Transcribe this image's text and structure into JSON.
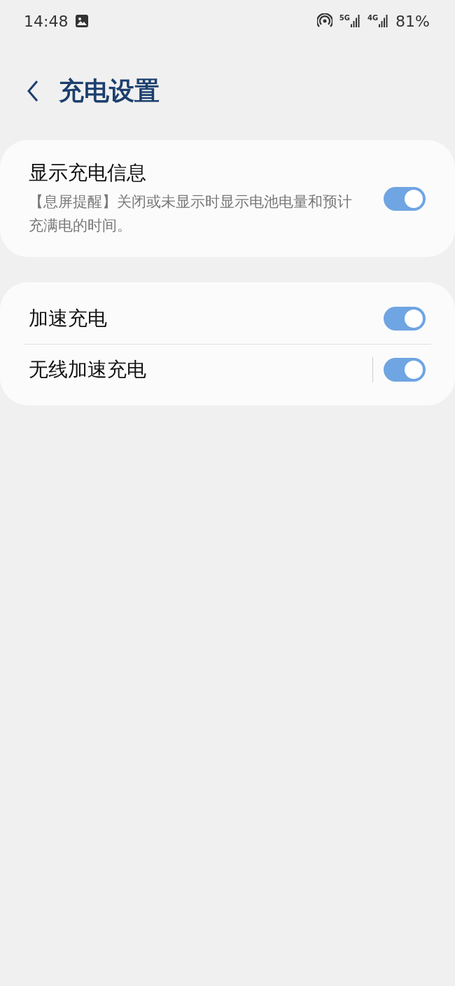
{
  "status_bar": {
    "time": "14:48",
    "networks": [
      "5G",
      "4G"
    ],
    "battery": "81%"
  },
  "header": {
    "title": "充电设置"
  },
  "groups": [
    {
      "items": [
        {
          "title": "显示充电信息",
          "subtitle": "【息屏提醒】关闭或未显示时显示电池电量和预计充满电的时间。",
          "on": true,
          "split": false
        }
      ]
    },
    {
      "items": [
        {
          "title": "加速充电",
          "on": true,
          "split": false
        },
        {
          "title": "无线加速充电",
          "on": true,
          "split": true
        }
      ]
    }
  ]
}
